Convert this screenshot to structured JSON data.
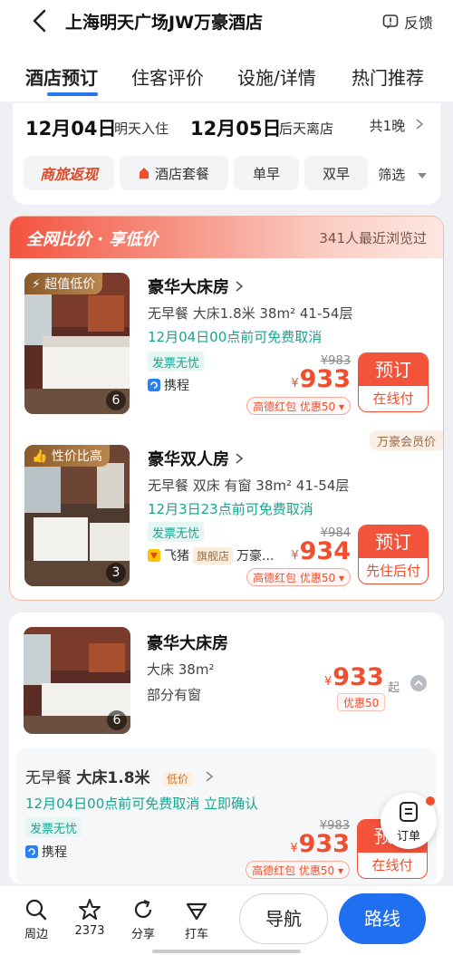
{
  "header": {
    "title": "上海明天广场JW万豪酒店",
    "feedback_label": "反馈",
    "tabs": [
      {
        "label": "酒店预订"
      },
      {
        "label": "住客评价"
      },
      {
        "label": "设施/详情"
      },
      {
        "label": "热门推荐"
      }
    ]
  },
  "dates": {
    "checkin_date": "12月04日",
    "checkin_note": "明天入住",
    "checkout_date": "12月05日",
    "checkout_note": "后天离店",
    "nights": "共1晚"
  },
  "filters": {
    "brand": "商旅返现",
    "items": [
      "酒店套餐",
      "单早",
      "双早"
    ],
    "select_label": "筛选"
  },
  "promo": {
    "title": "全网比价 · 享低价",
    "views": "341人最近浏览过",
    "rooms": [
      {
        "badge": "超值低价",
        "img_count": "6",
        "name": "豪华大床房",
        "spec": "无早餐  大床1.8米  38m²  41-54层",
        "cancel": "12月04日00点前可免费取消",
        "tag": "发票无忧",
        "source": "携程",
        "old_price": "¥983",
        "price": "933",
        "coupon": "高德红包  优惠50",
        "book_top": "预订",
        "book_bottom": "在线付"
      },
      {
        "badge": "性价比高",
        "img_count": "3",
        "name": "豪华双人房",
        "spec": "无早餐  双床  有窗  38m²  41-54层",
        "cancel": "12月3日23点前可免费取消",
        "tag": "发票无忧",
        "source": "飞猪",
        "source_tag": "旗舰店",
        "source_extra": "万豪...",
        "old_price": "¥984",
        "price": "934",
        "coupon": "高德红包  优惠50",
        "book_top": "预订",
        "book_bottom": "先住后付",
        "member": "万豪会员价"
      }
    ]
  },
  "room_list": {
    "room": {
      "img_count": "6",
      "name": "豪华大床房",
      "spec": "大床  38m²",
      "window": "部分有窗",
      "price": "933",
      "price_suffix": "起",
      "coupon": "优惠50"
    },
    "offer": {
      "title_plain": "无早餐 ",
      "title_bold": "大床1.8米",
      "low_tag": "低价",
      "cancel": "12月04日00点前可免费取消  立即确认",
      "tag": "发票无忧",
      "source": "携程",
      "old_price": "¥983",
      "price": "933",
      "coupon": "高德红包  优惠50",
      "book_top": "预订",
      "book_bottom": "在线付"
    }
  },
  "order_float": {
    "label": "订单"
  },
  "bottom_nav": {
    "items": [
      {
        "label": "周边"
      },
      {
        "label": "2373"
      },
      {
        "label": "分享"
      },
      {
        "label": "打车"
      }
    ],
    "navigate_label": "导航",
    "route_label": "路线"
  },
  "colors": {
    "accent_blue": "#1f6ff0",
    "price_red": "#f04e2e",
    "green": "#17a592"
  }
}
